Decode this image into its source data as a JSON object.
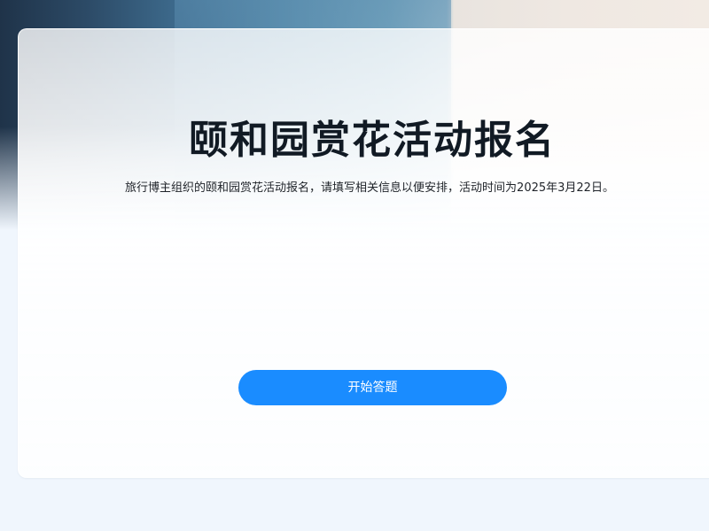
{
  "form": {
    "title": "颐和园赏花活动报名",
    "description": "旅行博主组织的颐和园赏花活动报名，请填写相关信息以便安排，活动时间为2025年3月22日。",
    "start_button_label": "开始答题"
  },
  "colors": {
    "accent": "#1a8cff",
    "title_text": "#111a24",
    "page_background": "#f0f6fd"
  }
}
